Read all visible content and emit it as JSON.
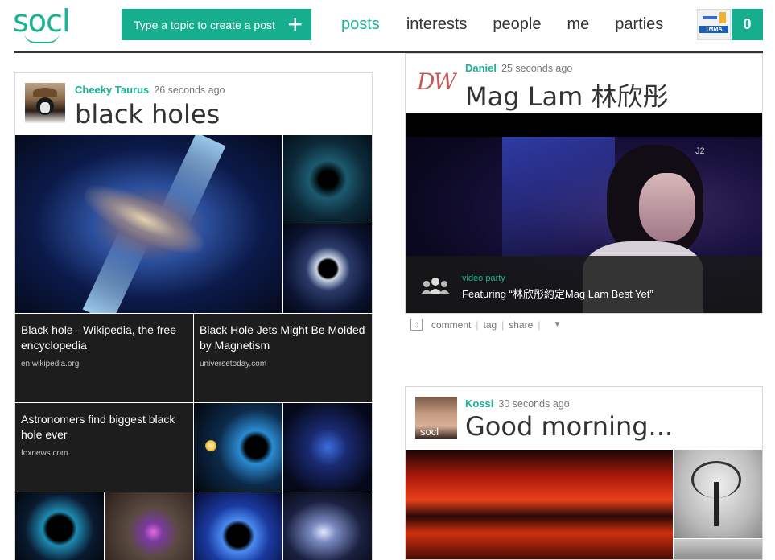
{
  "header": {
    "logo": "socl",
    "create_label": "Type a topic to create a post",
    "create_plus": "+",
    "nav": [
      "posts",
      "interests",
      "people",
      "me",
      "parties"
    ],
    "avatar_text": "TMMA",
    "notifications": "0"
  },
  "post1": {
    "author": "Cheeky Taurus",
    "time": "26 seconds ago",
    "title": "black holes",
    "links": [
      {
        "title": "Black hole - Wikipedia, the free encyclopedia",
        "url": "en.wikipedia.org"
      },
      {
        "title": "Black Hole Jets Might Be Molded by Magnetism",
        "url": "universetoday.com"
      },
      {
        "title": "Astronomers find biggest black hole ever",
        "url": "foxnews.com"
      }
    ]
  },
  "post2": {
    "author": "Daniel",
    "time": "25 seconds ago",
    "title": "Mag Lam 林欣彤",
    "avatar_text": "DW",
    "video_tag": "video party",
    "video_caption": "Featuring “林欣彤約定Mag Lam Best Yet”",
    "channel": "J2",
    "actions": [
      "comment",
      "tag",
      "share"
    ]
  },
  "post3": {
    "author": "Kossi",
    "time": "30 seconds ago",
    "title": "Good morning...",
    "avatar_text": "socl"
  },
  "colors": {
    "accent": "#1ab394",
    "dark_tile": "#1d1d1d"
  }
}
